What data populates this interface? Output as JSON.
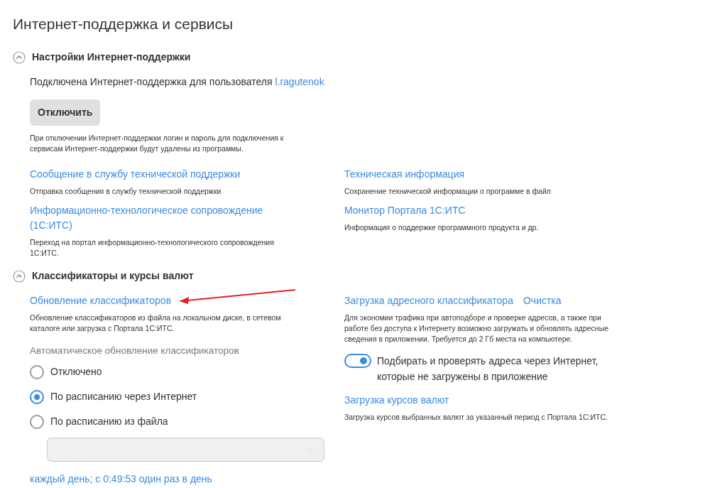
{
  "title": "Интернет-поддержка и сервисы",
  "sections": [
    {
      "title": "Настройки Интернет-поддержки",
      "expanded": true,
      "status": {
        "text": "Подключена Интернет-поддержка для пользователя",
        "user_link": "l.ragutenok"
      },
      "button": "Отключить",
      "note": "При отключении Интернет-поддержки логин и пароль для подключения к сервисам Интернет-поддержки будут удалены из программы.",
      "links": [
        {
          "label": "Сообщение в службу технической поддержки",
          "description": "Отправка сообщения в службу технической поддержки"
        },
        {
          "label": "Техническая информация",
          "description": "Сохранение технической информации о программе в файл"
        },
        {
          "label": "Информационно-технологическое сопровождение (1С:ИТС)",
          "description": "Переход на портал информационно-технологического сопровождения 1С:ИТС."
        },
        {
          "label": "Монитор Портала 1С:ИТС",
          "description": "Информация о поддержке программного продукта и др."
        }
      ]
    },
    {
      "title": "Классификаторы и курсы валют",
      "expanded": true,
      "classifiers": {
        "link": "Обновление классификаторов",
        "description": "Обновление классификаторов из файла на локальном диске, в сетевом каталоге или загрузка с Портала 1С:ИТС.",
        "auto_update_label": "Автоматическое обновление классификаторов",
        "options": [
          {
            "label": "Отключено",
            "selected": false
          },
          {
            "label": "По расписанию через Интернет",
            "selected": true
          },
          {
            "label": "По расписанию из файла",
            "selected": false
          }
        ],
        "file_field": {
          "disabled": true,
          "button": "···"
        },
        "schedule_link": "каждый день; с 0:49:53 один раз в день"
      },
      "address": {
        "link": "Загрузка адресного классификатора",
        "clear_link": "Очистка",
        "description": "Для экономии трафика при автоподборе и проверке адресов, а также при работе без доступа к Интернету возможно загружать и обновлять адресные сведения в приложении. Требуется до 2 Гб места на компьютере.",
        "toggle": {
          "label": "Подбирать и проверять адреса через Интернет, которые не загружены в приложение",
          "on": true
        }
      },
      "currency": {
        "link": "Загрузка курсов валют",
        "description": "Загрузка курсов выбранных валют за указанный период с Портала 1С:ИТС."
      }
    }
  ]
}
